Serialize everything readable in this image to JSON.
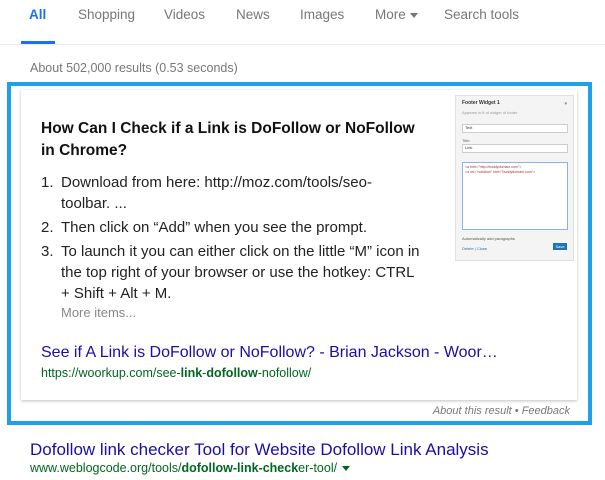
{
  "tabs": {
    "all": "All",
    "shopping": "Shopping",
    "videos": "Videos",
    "news": "News",
    "images": "Images",
    "more": "More",
    "search_tools": "Search tools"
  },
  "stats": "About 502,000 results (0.53 seconds)",
  "snippet": {
    "title_line1": "How Can I Check if a Link is DoFollow or NoFollow",
    "title_line2": "in Chrome?",
    "steps": [
      {
        "num": "1.",
        "text": "Download from here: http://moz.com/tools/seo-toolbar. ..."
      },
      {
        "num": "2.",
        "text": "Then click on “Add” when you see the prompt."
      },
      {
        "num": "3.",
        "text": "To launch it you can either click on the little “M” icon in the top right of your browser or use the hotkey: CTRL + Shift + Alt + M."
      }
    ],
    "more_items": "More items...",
    "result_title": "See if A Link is DoFollow or NoFollow? - Brian Jackson - Woor…",
    "url_prefix": "https://woorkup.com/see-",
    "url_bold1": "link",
    "url_mid": "-",
    "url_bold2": "dofollow",
    "url_suffix": "-nofollow/",
    "thumbnail": {
      "title": "Footer Widget 1",
      "caret": "▾",
      "subtitle": "Appears in ft of widget of footer",
      "select_value": "Text",
      "label_title": "Title:",
      "input_value": "Link",
      "label_content": "",
      "textarea_line1": "<a href=\"http://buddydomain.com\">",
      "textarea_line2": "<a rel=\"nofollow\" href=\"buddydomain.com\">",
      "checkbox_label": "Automatically add paragraphs",
      "links": "Delete | Close",
      "save_label": "Save"
    }
  },
  "about": {
    "about_result": "About this result",
    "separator": " • ",
    "feedback": "Feedback"
  },
  "result2": {
    "title": "Dofollow link checker Tool for Website Dofollow Link Analysis",
    "url_prefix": "www.weblogcode.org/tools/",
    "url_bold": "dofollow-link-check",
    "url_suffix": "er-tool/"
  },
  "colors": {
    "accent": "#1a73e8",
    "highlight": "#1da1e8",
    "link": "#1a0dab",
    "url": "#006621"
  }
}
